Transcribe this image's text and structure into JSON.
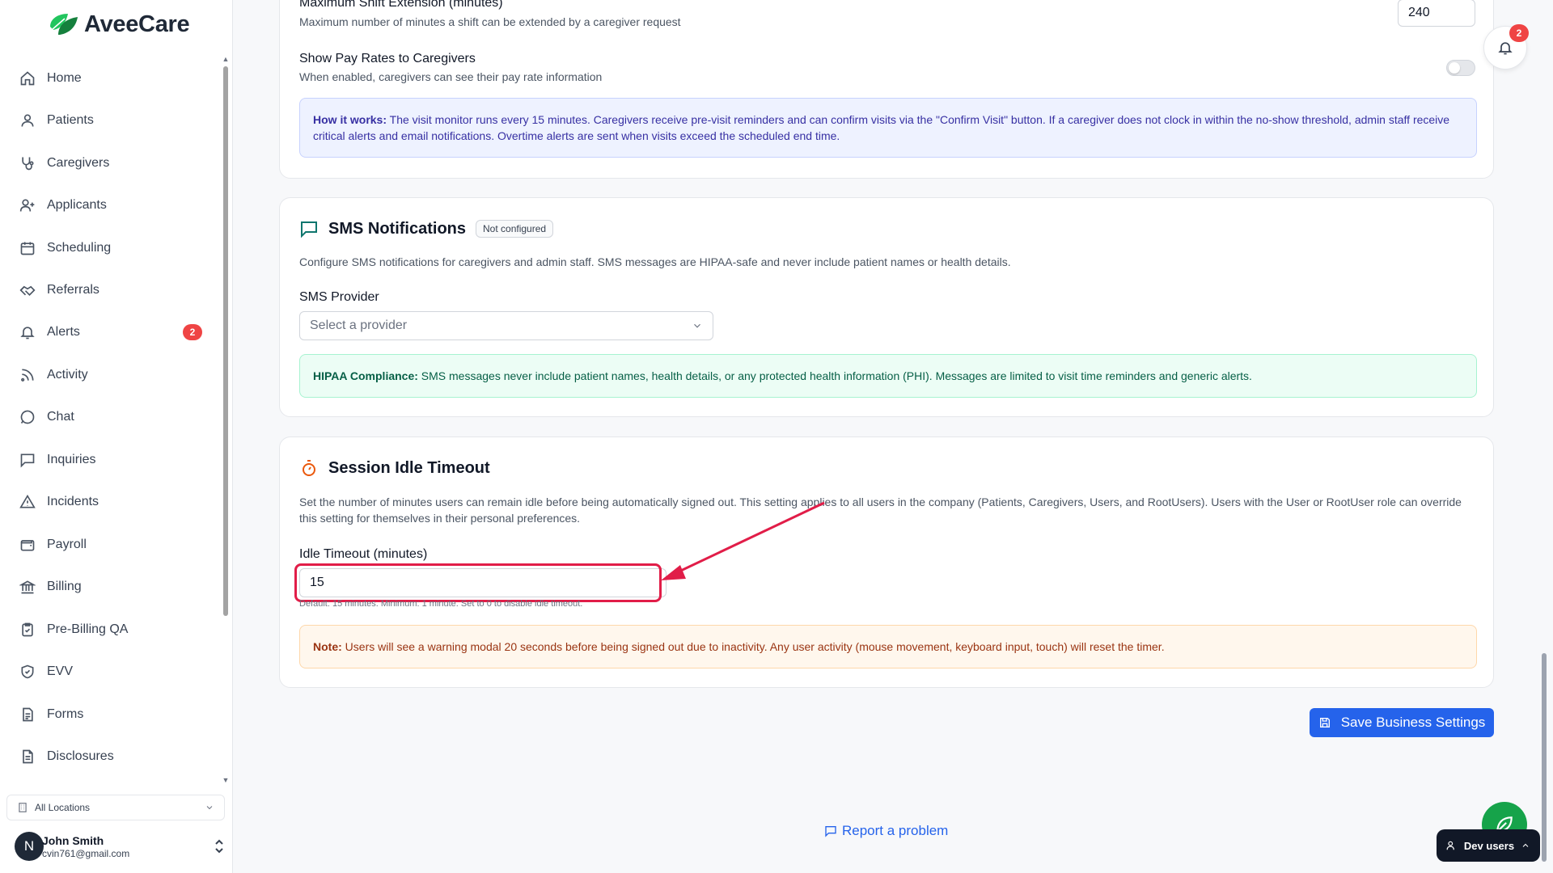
{
  "brand": {
    "name": "AveeCare",
    "color": "#16a34a"
  },
  "sidebar": {
    "items": [
      {
        "label": "Home",
        "icon": "home-icon"
      },
      {
        "label": "Patients",
        "icon": "user-icon"
      },
      {
        "label": "Caregivers",
        "icon": "stethoscope-icon"
      },
      {
        "label": "Applicants",
        "icon": "user-plus-icon"
      },
      {
        "label": "Scheduling",
        "icon": "calendar-icon"
      },
      {
        "label": "Referrals",
        "icon": "handshake-icon"
      },
      {
        "label": "Alerts",
        "icon": "bell-icon",
        "badge": "2"
      },
      {
        "label": "Activity",
        "icon": "rss-icon"
      },
      {
        "label": "Chat",
        "icon": "chat-icon"
      },
      {
        "label": "Inquiries",
        "icon": "message-square-icon"
      },
      {
        "label": "Incidents",
        "icon": "warning-icon"
      },
      {
        "label": "Payroll",
        "icon": "wallet-icon"
      },
      {
        "label": "Billing",
        "icon": "bank-icon"
      },
      {
        "label": "Pre-Billing QA",
        "icon": "clipboard-check-icon"
      },
      {
        "label": "EVV",
        "icon": "shield-check-icon"
      },
      {
        "label": "Forms",
        "icon": "file-text-icon"
      },
      {
        "label": "Disclosures",
        "icon": "document-icon"
      }
    ],
    "location_select": "All Locations",
    "user": {
      "initial": "N",
      "name": "John Smith",
      "email": "cvin761@gmail.com"
    }
  },
  "visit_card": {
    "max_extension_label": "Maximum Shift Extension (minutes)",
    "max_extension_help": "Maximum number of minutes a shift can be extended by a caregiver request",
    "max_extension_value": "240",
    "pay_rates_label": "Show Pay Rates to Caregivers",
    "pay_rates_help": "When enabled, caregivers can see their pay rate information",
    "pay_rates_enabled": false,
    "how_it_works_title": "How it works:",
    "how_it_works_text": "The visit monitor runs every 15 minutes. Caregivers receive pre-visit reminders and can confirm visits via the \"Confirm Visit\" button. If a caregiver does not clock in within the no-show threshold, admin staff receive critical alerts and email notifications. Overtime alerts are sent when visits exceed the scheduled end time."
  },
  "sms_card": {
    "title": "SMS Notifications",
    "status_pill": "Not configured",
    "description": "Configure SMS notifications for caregivers and admin staff. SMS messages are HIPAA-safe and never include patient names or health details.",
    "provider_label": "SMS Provider",
    "provider_placeholder": "Select a provider",
    "hipaa_title": "HIPAA Compliance:",
    "hipaa_text": "SMS messages never include patient names, health details, or any protected health information (PHI). Messages are limited to visit time reminders and generic alerts."
  },
  "idle_card": {
    "title": "Session Idle Timeout",
    "description": "Set the number of minutes users can remain idle before being automatically signed out. This setting applies to all users in the company (Patients, Caregivers, Users, and RootUsers). Users with the User or RootUser role can override this setting for themselves in their personal preferences.",
    "field_label": "Idle Timeout (minutes)",
    "field_value": "15",
    "field_help": "Default: 15 minutes. Minimum: 1 minute. Set to 0 to disable idle timeout.",
    "note_title": "Note:",
    "note_text": "Users will see a warning modal 20 seconds before being signed out due to inactivity. Any user activity (mouse movement, keyboard input, touch) will reset the timer."
  },
  "save_button": "Save Business Settings",
  "report_link": "Report a problem",
  "notifications_badge": "2",
  "dev_users": "Dev users",
  "colors": {
    "primary": "#2563eb",
    "danger": "#ef4444",
    "highlight": "#e11d48"
  }
}
